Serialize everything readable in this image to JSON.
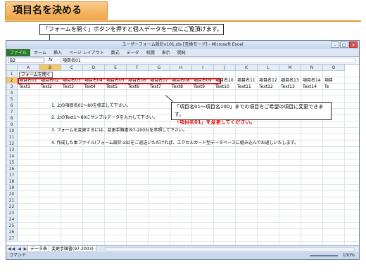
{
  "slide": {
    "title": "項目名を決める",
    "callout_top": "「フォームを開く」ボタンを押すと個人データを一度にご覧頂けます。",
    "callout_bottom_line1": "「項目名01～項目名100」までの項目をご希望の項目に変更できます。",
    "callout_bottom_line2": "「項目名01」を変更してください。"
  },
  "window": {
    "title": "ユーザーフォーム設計v101.xls [互換モード] - Microsoft Excel",
    "quick_access": "",
    "buttons": {
      "minimize": "–",
      "maximize": "□",
      "close": "×"
    }
  },
  "ribbon": {
    "tabs": [
      "ファイル",
      "ホーム",
      "挿入",
      "ページ レイアウト",
      "数式",
      "データ",
      "校閲",
      "表示",
      "開発"
    ]
  },
  "formula_bar": {
    "name_box": "B2",
    "fx": "fx",
    "content": "項目名01"
  },
  "grid": {
    "columns": [
      "A",
      "B",
      "C",
      "D",
      "E",
      "F",
      "G",
      "H",
      "I",
      "J",
      "K",
      "L",
      "M",
      "N",
      "O"
    ],
    "rows": [
      "1",
      "2",
      "3",
      "4",
      "5",
      "6",
      "7",
      "8",
      "9",
      "10",
      "11",
      "12",
      "13",
      "14",
      "15",
      "16",
      "17",
      "18",
      "19",
      "20",
      "21",
      "22",
      "23",
      "24",
      "25",
      "26",
      "27"
    ],
    "form_button": "フォームを開く",
    "row2": [
      "項目名01",
      "項目名02",
      "項目名03",
      "項目名04",
      "項目名05",
      "項目名06",
      "項目名07",
      "項目名08",
      "項目名09",
      "項目名10",
      "項目名11",
      "項目名12",
      "項目名13",
      "項目名14",
      "項目"
    ],
    "row3": [
      "Text1",
      "Text2",
      "Text3",
      "Text4",
      "Text5",
      "Text6",
      "Text7",
      "Text8",
      "Text9",
      "Text10",
      "Text11",
      "Text12",
      "Text13",
      "Text14",
      "Te"
    ],
    "instructions": [
      "1. 上の項目名01～80を修正して下さい。",
      "2. 上のText1～80にサンプルデータを入力して下さい。",
      "3. フォームを変更するには、変更手順書(97-2003)を参照して下さい。",
      "4. 作成した本ファイル(フォーム設計.xls)をご返送いただければ、エクセルカード型データベースに組み込んでお返しいたします。"
    ]
  },
  "sheet_tabs": [
    "データ表",
    "変更手順書(97-2003)"
  ],
  "sheet_nav": "◀◀ ◀ ▶ ▶▶",
  "status": {
    "ready": "コマンド",
    "zoom": "100%"
  }
}
